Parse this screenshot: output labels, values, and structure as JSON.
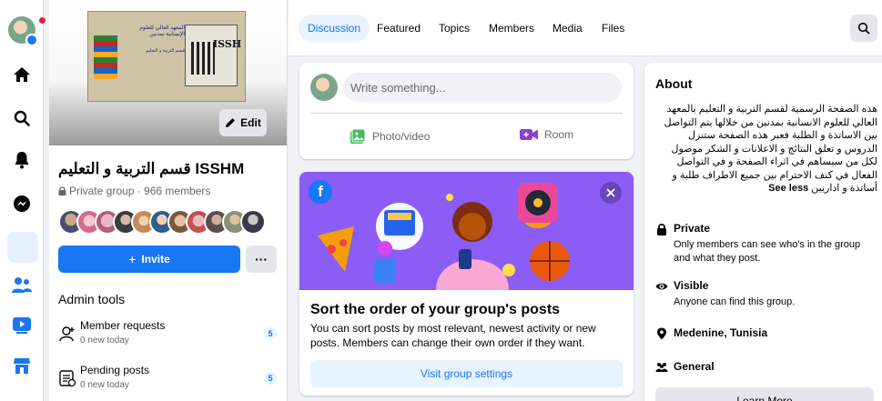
{
  "colors": {
    "brand": "#1877f2",
    "page_bg": "#f0f2f5",
    "secondary_text": "#65676b",
    "banner_purple": "#8b5cf6"
  },
  "rail": {
    "items": [
      {
        "name": "home-icon"
      },
      {
        "name": "search-icon"
      },
      {
        "name": "bell-icon"
      },
      {
        "name": "messenger-icon"
      },
      {
        "name": "menu-grid-icon"
      },
      {
        "name": "groups-icon"
      },
      {
        "name": "watch-icon"
      },
      {
        "name": "marketplace-icon"
      }
    ]
  },
  "group": {
    "cover": {
      "institute_text": "المعهد العالي للعلوم الإنسانية بمدنين",
      "dept_text": "قسم التربية و التعليم",
      "logo_text": "ISSH"
    },
    "edit_label": "Edit",
    "name": "قسم التربية و التعليم ISSHM",
    "meta": "Private group · 966 members",
    "invite_label": "Invite",
    "more_label": "···"
  },
  "admin": {
    "title": "Admin tools",
    "items": [
      {
        "title": "Member requests",
        "sub": "0 new today",
        "badge": "5"
      },
      {
        "title": "Pending posts",
        "sub": "0 new today",
        "badge": "5"
      }
    ]
  },
  "tabs": [
    "Discussion",
    "Featured",
    "Topics",
    "Members",
    "Media",
    "Files"
  ],
  "composer": {
    "placeholder": "Write something...",
    "photo_label": "Photo/video",
    "room_label": "Room"
  },
  "sort_card": {
    "title": "Sort the order of your group's posts",
    "desc": "You can sort posts by most relevant, newest activity or new posts. Members can change their own order if they want.",
    "button": "Visit group settings"
  },
  "about": {
    "title": "About",
    "desc": "هذه الصفحة الرسمية لقسم التربية و التعليم بالمعهد العالي للعلوم الانسانية بمدنين من خلالها يتم التواصل بين الاساتذة و الطلبة فعبر هذه الصفحة ستنزل الدروس و تعلق النتائج و الاعلانات و الشكر موصول لكل من سيساهم في اثراء الصفحة و في التواصل الفعال في كنف الاحترام بين جميع الاطراف طلبة و أساتذة و اداريين",
    "see_less": "See less",
    "private_title": "Private",
    "private_desc": "Only members can see who's in the group and what they post.",
    "visible_title": "Visible",
    "visible_desc": "Anyone can find this group.",
    "location": "Medenine, Tunisia",
    "category": "General",
    "learn_more": "Learn More"
  }
}
